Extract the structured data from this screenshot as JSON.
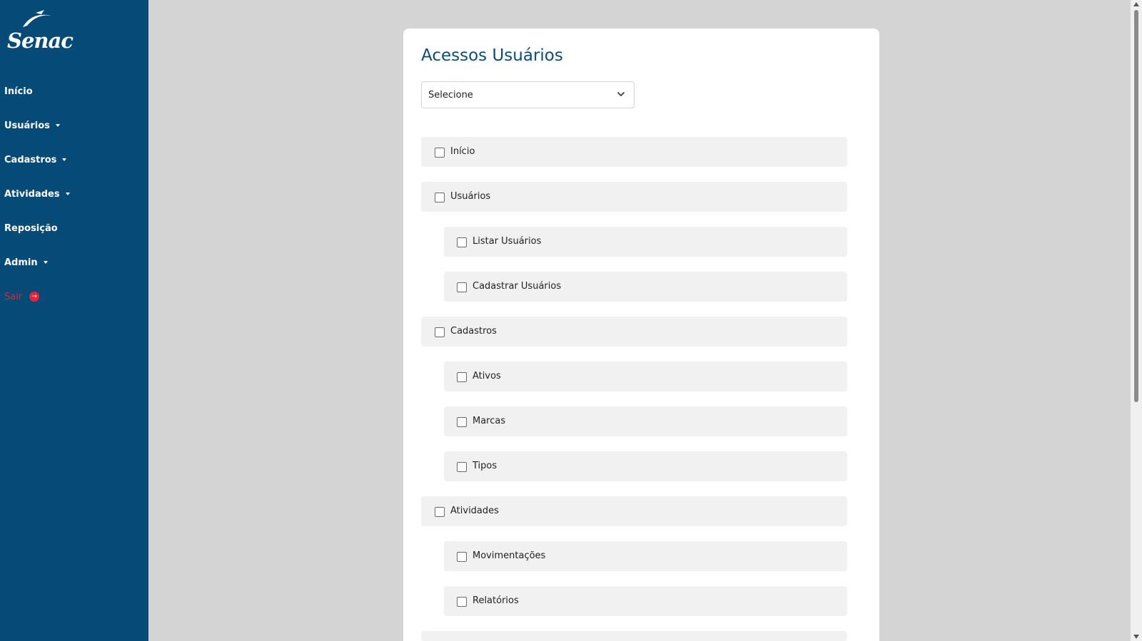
{
  "brand": {
    "logo_text": "Senac"
  },
  "sidebar": {
    "items": [
      {
        "label": "Início",
        "dropdown": false
      },
      {
        "label": "Usuários",
        "dropdown": true
      },
      {
        "label": "Cadastros",
        "dropdown": true
      },
      {
        "label": "Atividades",
        "dropdown": true
      },
      {
        "label": "Reposição",
        "dropdown": false
      },
      {
        "label": "Admin",
        "dropdown": true
      }
    ],
    "exit": {
      "label": "Sair",
      "icon": "exit-icon"
    }
  },
  "page": {
    "title": "Acessos Usuários",
    "select": {
      "value": "Selecione"
    }
  },
  "permissions": [
    {
      "label": "Início",
      "level": 0,
      "checked": false
    },
    {
      "label": "Usuários",
      "level": 0,
      "checked": false
    },
    {
      "label": "Listar Usuários",
      "level": 1,
      "checked": false
    },
    {
      "label": "Cadastrar Usuários",
      "level": 1,
      "checked": false
    },
    {
      "label": "Cadastros",
      "level": 0,
      "checked": false
    },
    {
      "label": "Ativos",
      "level": 1,
      "checked": false
    },
    {
      "label": "Marcas",
      "level": 1,
      "checked": false
    },
    {
      "label": "Tipos",
      "level": 1,
      "checked": false
    },
    {
      "label": "Atividades",
      "level": 0,
      "checked": false
    },
    {
      "label": "Movimentações",
      "level": 1,
      "checked": false
    },
    {
      "label": "Relatórios",
      "level": 1,
      "checked": false
    }
  ],
  "colors": {
    "sidebar": "#064a77",
    "title": "#0d4c79",
    "exit": "#e5233a",
    "background": "#d4d4d4"
  }
}
